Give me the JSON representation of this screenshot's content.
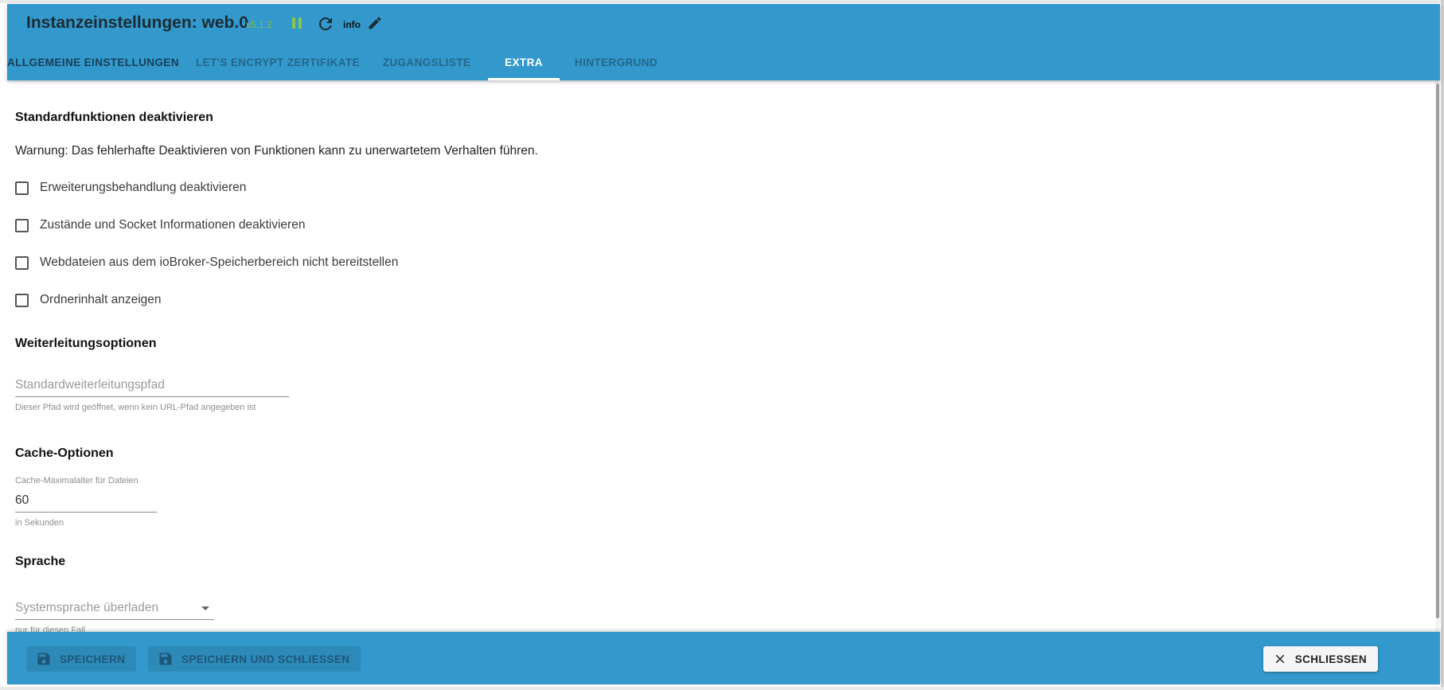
{
  "header": {
    "title": "Instanzeinstellungen: web.0",
    "version": "v5.1.2",
    "info_label": "info",
    "colors": {
      "bar": "#3399cc",
      "version": "#7fbf3f",
      "pause": "#8bc34a"
    }
  },
  "tabs": [
    {
      "label": "ALLGEMEINE EINSTELLUNGEN",
      "active": false
    },
    {
      "label": "LET'S ENCRYPT ZERTIFIKATE",
      "active": false
    },
    {
      "label": "ZUGANGSLISTE",
      "active": false
    },
    {
      "label": "EXTRA",
      "active": true
    },
    {
      "label": "HINTERGRUND",
      "active": false
    }
  ],
  "sections": {
    "standard": {
      "title": "Standardfunktionen deaktivieren",
      "warning": "Warnung: Das fehlerhafte Deaktivieren von Funktionen kann zu unerwartetem Verhalten führen.",
      "checkboxes": [
        {
          "label": "Erweiterungsbehandlung deaktivieren",
          "checked": false
        },
        {
          "label": "Zustände und Socket Informationen deaktivieren",
          "checked": false
        },
        {
          "label": "Webdateien aus dem ioBroker-Speicherbereich nicht bereitstellen",
          "checked": false
        },
        {
          "label": "Ordnerinhalt anzeigen",
          "checked": false
        }
      ]
    },
    "redirect": {
      "title": "Weiterleitungsoptionen",
      "field_placeholder": "Standardweiterleitungspfad",
      "field_value": "",
      "helper": "Dieser Pfad wird geöffnet, wenn kein URL-Pfad angegeben ist"
    },
    "cache": {
      "title": "Cache-Optionen",
      "field_label": "Cache-Maximalalter für Dateien",
      "field_value": "60",
      "helper": "in Sekunden"
    },
    "language": {
      "title": "Sprache",
      "select_value": "Systemsprache überladen",
      "helper": "nur für diesen Fall"
    }
  },
  "footer": {
    "save_label": "SPEICHERN",
    "save_close_label": "SPEICHERN UND SCHLIESSEN",
    "close_label": "SCHLIESSEN"
  }
}
